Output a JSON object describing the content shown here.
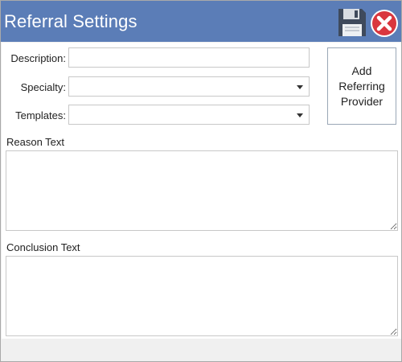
{
  "window": {
    "title": "Referral Settings"
  },
  "toolbar": {
    "save_icon": "floppy-disk-icon",
    "close_icon": "red-x-circle-icon"
  },
  "form": {
    "description_label": "Description:",
    "description_value": "",
    "specialty_label": "Specialty:",
    "specialty_value": "",
    "templates_label": "Templates:",
    "templates_value": "",
    "add_button_label": "Add Referring Provider",
    "reason_label": "Reason Text",
    "reason_value": "",
    "conclusion_label": "Conclusion Text",
    "conclusion_value": ""
  },
  "colors": {
    "titlebar": "#5b7db7",
    "close_red": "#d9363e"
  }
}
